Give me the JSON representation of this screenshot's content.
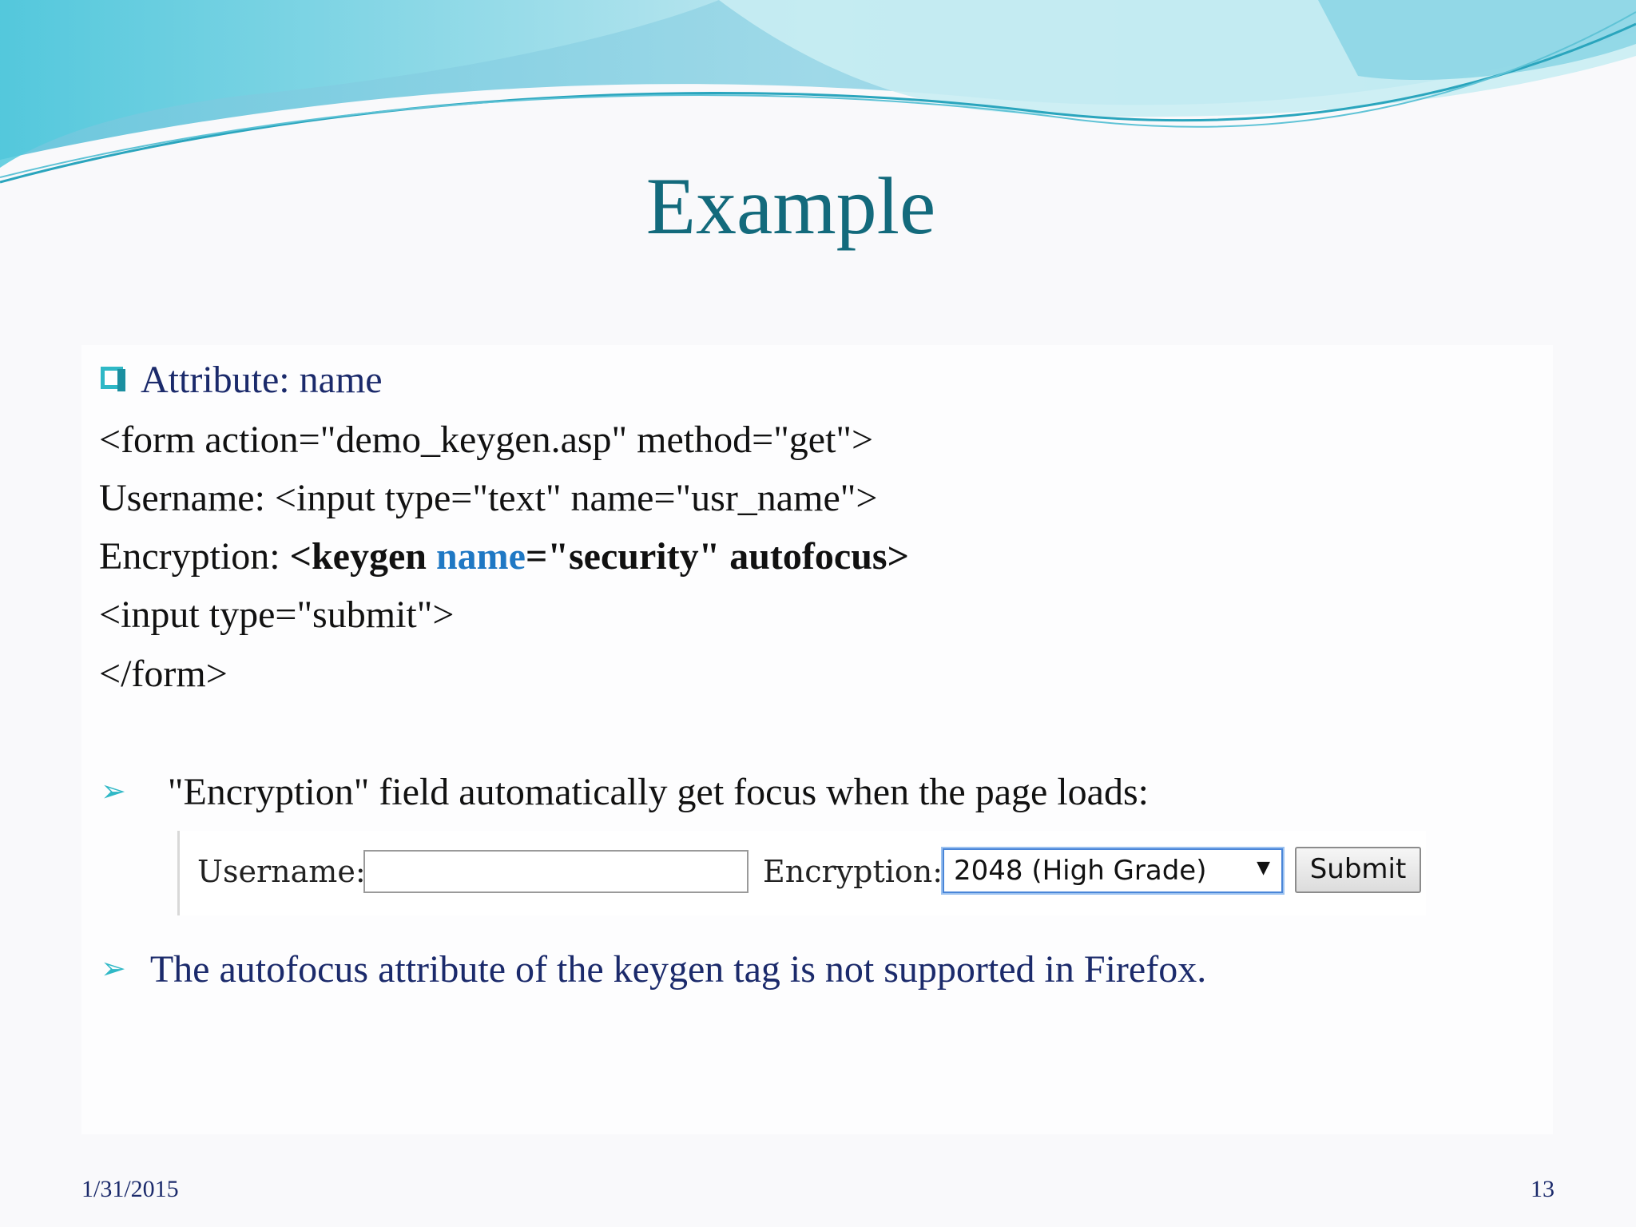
{
  "slide": {
    "title": "Example",
    "attribute_line": "Attribute: name",
    "code": {
      "line1": "<form action=\"demo_keygen.asp\" method=\"get\">",
      "line2": "Username: <input type=\"text\" name=\"usr_name\">",
      "line3_prefix": "Encryption: ",
      "line3_keygen": "<keygen ",
      "line3_name": "name",
      "line3_rest": "=\"security\" autofocus>",
      "line4": "<input type=\"submit\">",
      "line5": "</form>"
    },
    "bullet1": "\"Encryption\" field automatically get focus when the page loads:",
    "bullet2": "The autofocus attribute of the keygen tag is not supported in Firefox.",
    "form_demo": {
      "username_label": "Username:",
      "username_value": "",
      "encryption_label": "Encryption:",
      "encryption_selected": "2048 (High Grade)",
      "submit_label": "Submit"
    },
    "footer": {
      "date": "1/31/2015",
      "page_number": "13"
    },
    "colors": {
      "title": "#136a7c",
      "accent": "#2fb8c6",
      "navy_text": "#1b2a6b",
      "highlight_blue": "#1f78c4"
    }
  }
}
